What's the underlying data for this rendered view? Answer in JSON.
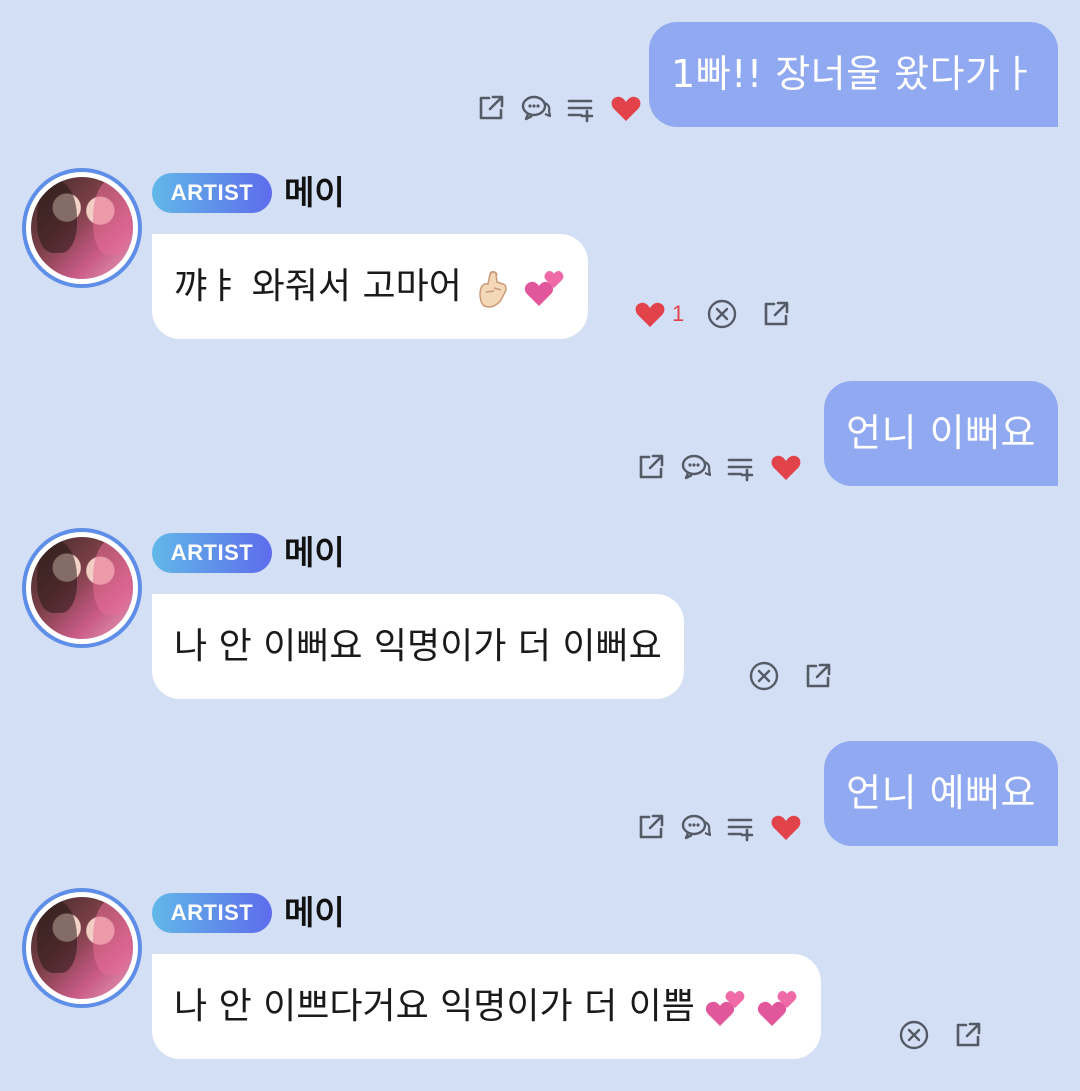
{
  "messages": [
    {
      "type": "outgoing",
      "text": "1빠!! 장너울 왔다가ㅏ"
    },
    {
      "type": "incoming",
      "badge": "ARTIST",
      "name": "메이",
      "text": "꺄ㅑ 와줘서 고마어",
      "emojis": [
        "finger-heart-emoji",
        "two-hearts-emoji"
      ],
      "heart_count": "1"
    },
    {
      "type": "outgoing",
      "text": "언니 이뻐요"
    },
    {
      "type": "incoming",
      "badge": "ARTIST",
      "name": "메이",
      "text": "나 안 이뻐요 익명이가 더 이뻐요",
      "emojis": []
    },
    {
      "type": "outgoing",
      "text": "언니 예뻐요"
    },
    {
      "type": "incoming",
      "badge": "ARTIST",
      "name": "메이",
      "text": "나 안 이쁘다거요 익명이가 더 이쁨",
      "emojis": [
        "two-hearts-emoji",
        "two-hearts-emoji"
      ]
    }
  ],
  "colors": {
    "background": "#d3dff5",
    "outgoing_bubble": "#91a9f0",
    "incoming_bubble": "#ffffff",
    "heart": "#e2434b",
    "icon": "#555b66",
    "badge_gradient": [
      "#61b8e8",
      "#5e6cec"
    ]
  },
  "icons": {
    "outgoing_actions": [
      "share-icon",
      "comment-icon",
      "add-to-list-icon",
      "heart-icon"
    ],
    "incoming_actions": [
      "heart-icon",
      "close-circle-icon",
      "share-icon"
    ]
  }
}
